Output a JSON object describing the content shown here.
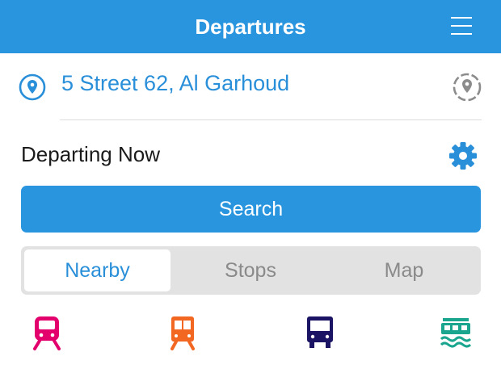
{
  "header": {
    "title": "Departures",
    "menu_icon": "hamburger-menu-icon"
  },
  "location": {
    "text": "5 Street 62, Al Garhoud",
    "pin_icon": "location-pin-icon",
    "locate_icon": "locate-me-icon"
  },
  "departure": {
    "text": "Departing Now",
    "settings_icon": "gear-icon"
  },
  "search": {
    "label": "Search"
  },
  "tabs": [
    {
      "label": "Nearby",
      "active": true
    },
    {
      "label": "Stops",
      "active": false
    },
    {
      "label": "Map",
      "active": false
    }
  ],
  "transport_modes": [
    {
      "icon": "metro-icon",
      "color": "#e3006d"
    },
    {
      "icon": "tram-icon",
      "color": "#f26722"
    },
    {
      "icon": "bus-icon",
      "color": "#1b1464"
    },
    {
      "icon": "ferry-icon",
      "color": "#1aa58f"
    }
  ],
  "colors": {
    "accent": "#2a95df",
    "text_link": "#2a8fd9"
  }
}
